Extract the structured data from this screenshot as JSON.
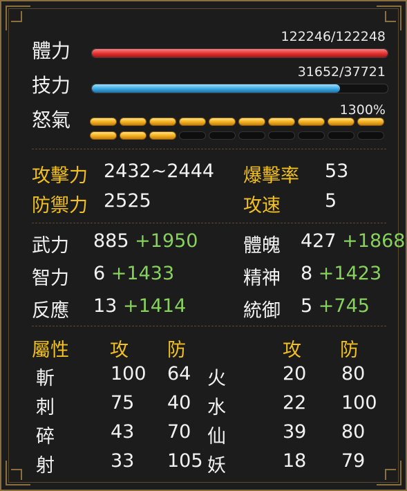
{
  "vitals": {
    "hp": {
      "label": "體力",
      "text": "122246/122248",
      "current": 122246,
      "max": 122248
    },
    "sp": {
      "label": "技力",
      "text": "31652/37721",
      "current": 31652,
      "max": 37721
    },
    "rage": {
      "label": "怒氣",
      "text": "1300%",
      "filled_segments": 13,
      "total_segments": 20
    }
  },
  "combat": {
    "attack": {
      "label": "攻擊力",
      "value": "2432~2444"
    },
    "crit": {
      "label": "爆擊率",
      "value": "53"
    },
    "defense": {
      "label": "防禦力",
      "value": "2525"
    },
    "speed": {
      "label": "攻速",
      "value": "5"
    }
  },
  "attributes": {
    "str": {
      "label": "武力",
      "base": "885",
      "bonus": "+1950"
    },
    "con": {
      "label": "體魄",
      "base": "427",
      "bonus": "+1868"
    },
    "int": {
      "label": "智力",
      "base": "6",
      "bonus": "+1433"
    },
    "spi": {
      "label": "精神",
      "base": "8",
      "bonus": "+1423"
    },
    "ref": {
      "label": "反應",
      "base": "13",
      "bonus": "+1414"
    },
    "cmd": {
      "label": "統御",
      "base": "5",
      "bonus": "+745"
    }
  },
  "elements": {
    "header": {
      "title": "屬性",
      "atk": "攻",
      "def": "防",
      "atk2": "攻",
      "def2": "防"
    },
    "left": [
      {
        "name": "斬",
        "atk": "100",
        "def": "64"
      },
      {
        "name": "刺",
        "atk": "75",
        "def": "40"
      },
      {
        "name": "碎",
        "atk": "43",
        "def": "70"
      },
      {
        "name": "射",
        "atk": "33",
        "def": "105"
      }
    ],
    "right": [
      {
        "name": "火",
        "atk": "20",
        "def": "80"
      },
      {
        "name": "水",
        "atk": "22",
        "def": "100"
      },
      {
        "name": "仙",
        "atk": "39",
        "def": "80"
      },
      {
        "name": "妖",
        "atk": "18",
        "def": "79"
      }
    ]
  },
  "colors": {
    "gold": "#f2c020",
    "bonus": "#86d25c",
    "hp": "#e03030",
    "sp": "#3aa6e0",
    "rage": "#f5b321"
  }
}
